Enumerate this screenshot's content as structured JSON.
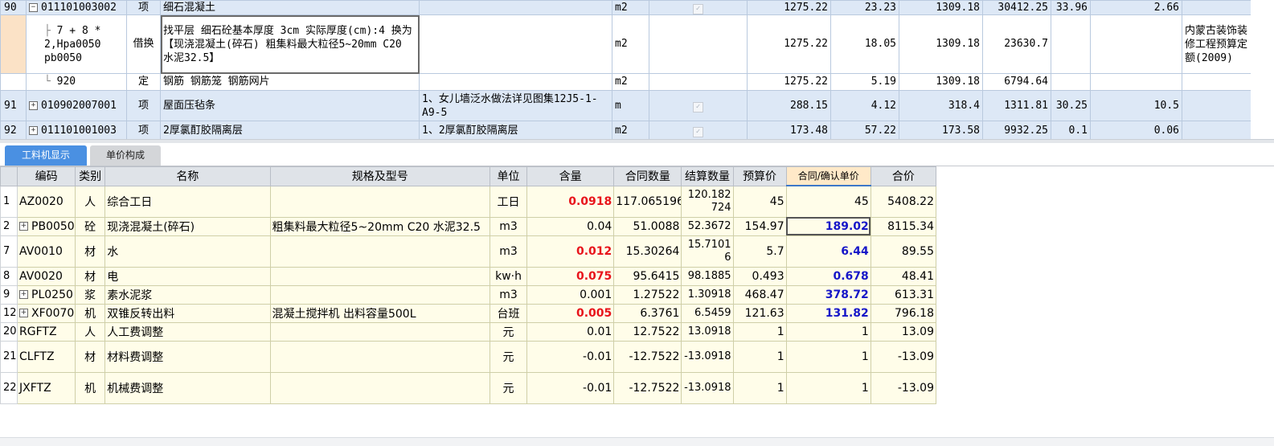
{
  "top_rows": [
    {
      "kind": "item",
      "rowno": "90",
      "expand": "−",
      "code": "011101003002",
      "type": "项",
      "name": "细石混凝土",
      "spec": "",
      "unit": "m2",
      "checked": true,
      "c1": "1275.22",
      "c2": "23.23",
      "c3": "1309.18",
      "c4": "30412.25",
      "c5": "33.96",
      "c6": "2.66",
      "c7": ""
    },
    {
      "kind": "sub",
      "rowno": "",
      "code": "7 + 8 * 2,Hpa0050 pb0050",
      "type": "借换",
      "name": "找平层 细石砼基本厚度 3cm    实际厚度(cm):4  换为【现浇混凝土(碎石) 粗集料最大粒径5~20mm C20 水泥32.5】",
      "spec": "",
      "unit": "m2",
      "c1": "1275.22",
      "c2": "18.05",
      "c3": "1309.18",
      "c4": "23630.7",
      "c5": "",
      "c6": "",
      "c7": "内蒙古装饰装修工程预算定额(2009)"
    },
    {
      "kind": "sub",
      "rowno": "",
      "code": "920",
      "type": "定",
      "name": "钢筋 钢筋笼 钢筋网片",
      "spec": "",
      "unit": "m2",
      "c1": "1275.22",
      "c2": "5.19",
      "c3": "1309.18",
      "c4": "6794.64",
      "c5": "",
      "c6": "",
      "c7": ""
    },
    {
      "kind": "item",
      "rowno": "91",
      "expand": "+",
      "code": "010902007001",
      "type": "项",
      "name": "屋面压毡条",
      "spec": "1、女儿墙泛水做法详见图集12J5-1-A9-5",
      "unit": "m",
      "checked": true,
      "c1": "288.15",
      "c2": "4.12",
      "c3": "318.4",
      "c4": "1311.81",
      "c5": "30.25",
      "c6": "10.5",
      "c7": ""
    },
    {
      "kind": "item",
      "rowno": "92",
      "expand": "+",
      "code": "011101001003",
      "type": "项",
      "name": "2厚氯酊胶隔离层",
      "spec": "1、2厚氯酊胶隔离层",
      "unit": "m2",
      "checked": true,
      "c1": "173.48",
      "c2": "57.22",
      "c3": "173.58",
      "c4": "9932.25",
      "c5": "0.1",
      "c6": "0.06",
      "c7": ""
    }
  ],
  "tabs": {
    "active": "工料机显示",
    "inactive": "单价构成"
  },
  "headers": {
    "code": "编码",
    "cat": "类别",
    "name": "名称",
    "spec": "规格及型号",
    "unit": "单位",
    "qty": "含量",
    "cq": "合同数量",
    "sq": "结算数量",
    "bp": "预算价",
    "cp": "合同/确认单价",
    "total": "合价"
  },
  "rows": [
    {
      "idx": "1",
      "code": "AZ0020",
      "cat": "人",
      "name": "综合工日",
      "spec": "",
      "unit": "工日",
      "qty": "0.0918",
      "qty_red": true,
      "cq": "117.065196",
      "sq": "120.182724",
      "bp": "45",
      "cp": "45",
      "cp_blue": false,
      "total": "5408.22",
      "tall": true
    },
    {
      "idx": "2",
      "code": "PB0050",
      "expand": true,
      "cat": "砼",
      "name": "现浇混凝土(碎石)",
      "spec": "粗集料最大粒径5~20mm C20 水泥32.5",
      "unit": "m3",
      "qty": "0.04",
      "qty_red": false,
      "cq": "51.0088",
      "sq": "52.3672",
      "bp": "154.97",
      "cp": "189.02",
      "cp_blue": true,
      "total": "8115.34",
      "focus": true
    },
    {
      "idx": "7",
      "code": "AV0010",
      "cat": "材",
      "name": "水",
      "spec": "",
      "unit": "m3",
      "qty": "0.012",
      "qty_red": true,
      "cq": "15.30264",
      "sq": "15.71016",
      "bp": "5.7",
      "cp": "6.44",
      "cp_blue": true,
      "total": "89.55",
      "tall": true
    },
    {
      "idx": "8",
      "code": "AV0020",
      "cat": "材",
      "name": "电",
      "spec": "",
      "unit": "kw·h",
      "qty": "0.075",
      "qty_red": true,
      "cq": "95.6415",
      "sq": "98.1885",
      "bp": "0.493",
      "cp": "0.678",
      "cp_blue": true,
      "total": "48.41"
    },
    {
      "idx": "9",
      "code": "PL0250",
      "expand": true,
      "cat": "浆",
      "name": "素水泥浆",
      "spec": "",
      "unit": "m3",
      "qty": "0.001",
      "qty_red": false,
      "cq": "1.27522",
      "sq": "1.30918",
      "bp": "468.47",
      "cp": "378.72",
      "cp_blue": true,
      "total": "613.31"
    },
    {
      "idx": "12",
      "code": "XF0070",
      "expand": true,
      "cat": "机",
      "name": "双锥反转出料",
      "spec": "混凝土搅拌机 出料容量500L",
      "unit": "台班",
      "qty": "0.005",
      "qty_red": true,
      "cq": "6.3761",
      "sq": "6.5459",
      "bp": "121.63",
      "cp": "131.82",
      "cp_blue": true,
      "total": "796.18"
    },
    {
      "idx": "20",
      "code": "RGFTZ",
      "cat": "人",
      "name": "人工费调整",
      "spec": "",
      "unit": "元",
      "qty": "0.01",
      "qty_red": false,
      "cq": "12.7522",
      "sq": "13.0918",
      "bp": "1",
      "cp": "1",
      "cp_blue": false,
      "total": "13.09"
    },
    {
      "idx": "21",
      "code": "CLFTZ",
      "cat": "材",
      "name": "材料费调整",
      "spec": "",
      "unit": "元",
      "qty": "-0.01",
      "qty_red": false,
      "cq": "-12.7522",
      "sq": "-13.0918",
      "bp": "1",
      "cp": "1",
      "cp_blue": false,
      "total": "-13.09",
      "tall": true
    },
    {
      "idx": "22",
      "code": "JXFTZ",
      "cat": "机",
      "name": "机械费调整",
      "spec": "",
      "unit": "元",
      "qty": "-0.01",
      "qty_red": false,
      "cq": "-12.7522",
      "sq": "-13.0918",
      "bp": "1",
      "cp": "1",
      "cp_blue": false,
      "total": "-13.09",
      "tall": true
    }
  ]
}
